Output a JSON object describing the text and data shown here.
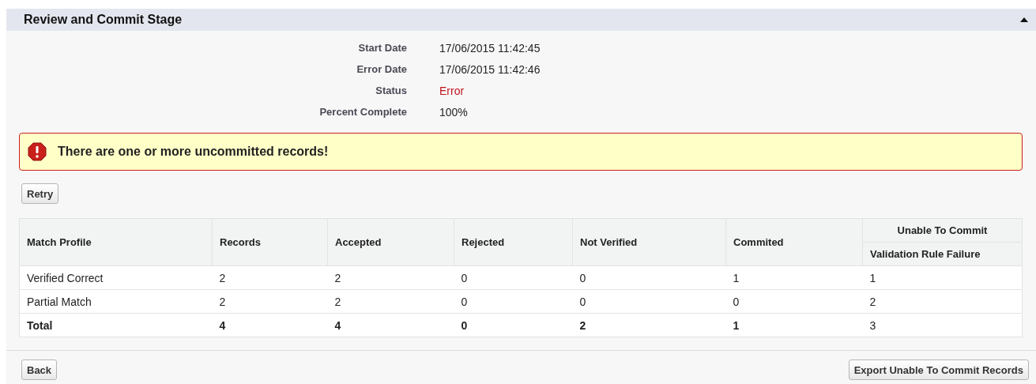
{
  "panel": {
    "title": "Review and Commit Stage",
    "expanded": true
  },
  "details": [
    {
      "label": "Start Date",
      "value": "17/06/2015 11:42:45",
      "kind": "normal"
    },
    {
      "label": "Error Date",
      "value": "17/06/2015 11:42:46",
      "kind": "normal"
    },
    {
      "label": "Status",
      "value": "Error",
      "kind": "error"
    },
    {
      "label": "Percent Complete",
      "value": "100%",
      "kind": "normal"
    }
  ],
  "alert": {
    "kind": "error",
    "message": "There are one or more uncommitted records!"
  },
  "actions": [
    "Retry"
  ],
  "table": {
    "columns": [
      "Match Profile",
      "Records",
      "Accepted",
      "Rejected",
      "Not Verified",
      "Commited"
    ],
    "group_column": {
      "label": "Unable To Commit",
      "subcolumns": [
        "Validation Rule Failure"
      ]
    },
    "rows": [
      {
        "cells": [
          {
            "text": "Verified Correct",
            "bold": false
          },
          {
            "text": "2",
            "bold": false
          },
          {
            "text": "2",
            "bold": false
          },
          {
            "text": "0",
            "bold": false
          },
          {
            "text": "0",
            "bold": false
          },
          {
            "text": "1",
            "bold": false
          },
          {
            "text": "1",
            "bold": false
          }
        ]
      },
      {
        "cells": [
          {
            "text": "Partial Match",
            "bold": false
          },
          {
            "text": "2",
            "bold": false
          },
          {
            "text": "2",
            "bold": false
          },
          {
            "text": "0",
            "bold": false
          },
          {
            "text": "0",
            "bold": false
          },
          {
            "text": "0",
            "bold": false
          },
          {
            "text": "2",
            "bold": false
          }
        ]
      },
      {
        "cells": [
          {
            "text": "Total",
            "bold": true
          },
          {
            "text": "4",
            "bold": true
          },
          {
            "text": "4",
            "bold": true
          },
          {
            "text": "0",
            "bold": true
          },
          {
            "text": "2",
            "bold": true
          },
          {
            "text": "1",
            "bold": true
          },
          {
            "text": "3",
            "bold": false
          }
        ]
      }
    ]
  },
  "footer": {
    "left_button": "Back",
    "right_button": "Export Unable To Commit Records"
  }
}
